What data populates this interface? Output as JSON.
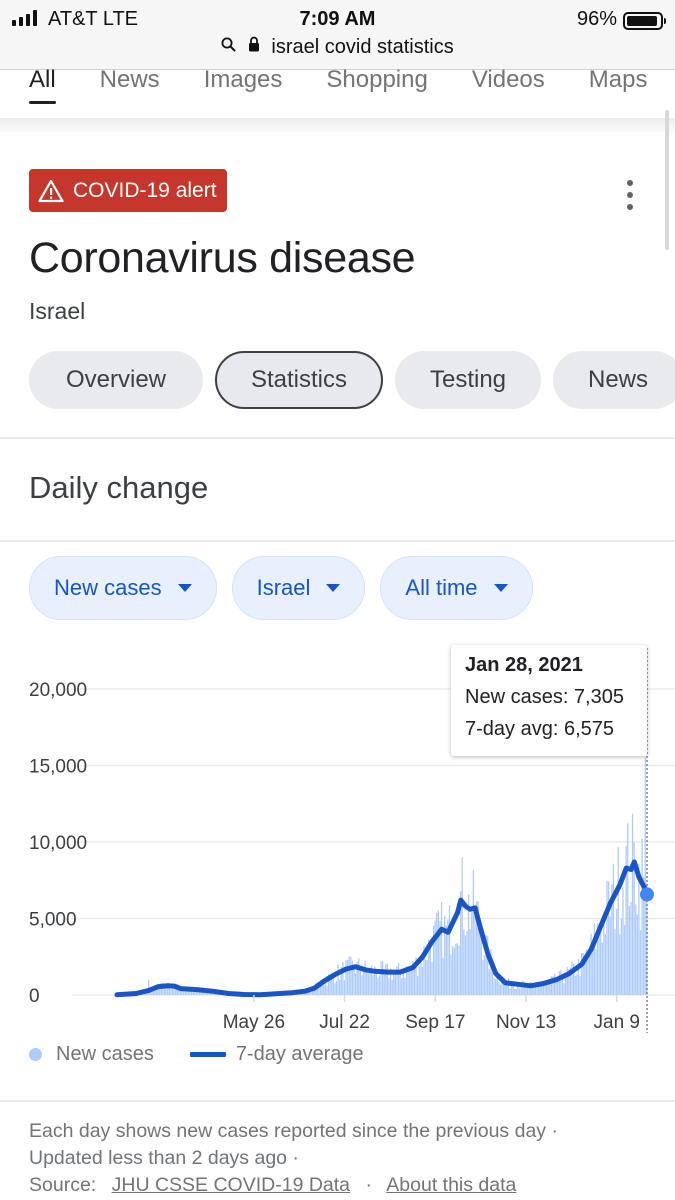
{
  "status_bar": {
    "carrier": "AT&T  LTE",
    "time": "7:09 AM",
    "battery": "96%",
    "battery_level": 0.96
  },
  "address_bar": {
    "search_icon": "search-icon",
    "lock_icon": "lock-icon",
    "query": "israel covid statistics"
  },
  "search_tabs": [
    {
      "label": "All",
      "active": true
    },
    {
      "label": "News",
      "active": false
    },
    {
      "label": "Images",
      "active": false
    },
    {
      "label": "Shopping",
      "active": false
    },
    {
      "label": "Videos",
      "active": false
    },
    {
      "label": "Maps",
      "active": false
    }
  ],
  "card": {
    "alert_icon": "warning-icon",
    "alert_label": "COVID-19 alert",
    "alert_color": "#c5362d",
    "more_icon": "more-vert-icon",
    "title": "Coronavirus disease",
    "subtitle": "Israel",
    "chips": [
      {
        "label": "Overview",
        "selected": false
      },
      {
        "label": "Statistics",
        "selected": true
      },
      {
        "label": "Testing",
        "selected": false
      },
      {
        "label": "News",
        "selected": false
      }
    ]
  },
  "section": {
    "title": "Daily change",
    "filters": [
      {
        "label": "New cases"
      },
      {
        "label": "Israel"
      },
      {
        "label": "All time"
      }
    ]
  },
  "tooltip": {
    "date": "Jan 28, 2021",
    "new_cases": "New cases: 7,305",
    "avg": "7-day avg: 6,575"
  },
  "legend": {
    "new_cases": "New cases",
    "avg": "7-day average"
  },
  "footer": {
    "line1": "Each day shows new cases reported since the previous day ·",
    "line2": "Updated less than 2 days ago  ·",
    "source_label": "Source:",
    "source_link": "JHU CSSE COVID-19 Data",
    "about_link": "About this data"
  },
  "chart_data": {
    "type": "bar",
    "title": "Daily change",
    "xlabel": "",
    "ylabel": "",
    "ylim": [
      0,
      20000
    ],
    "yticks": [
      0,
      5000,
      10000,
      15000,
      20000
    ],
    "ytick_labels": [
      "0",
      "5,000",
      "10,000",
      "15,000",
      "20,000"
    ],
    "x_start": "2020-03-01",
    "x_end": "2021-01-28",
    "x_range_days": [
      0,
      333
    ],
    "xticks_day": [
      86,
      143,
      200,
      257,
      314
    ],
    "xtick_labels": [
      "May 26",
      "Jul 22",
      "Sep 17",
      "Nov 13",
      "Jan 9"
    ],
    "grid": true,
    "legend_position": "bottom-left",
    "colors": {
      "bars": "#aecbfa",
      "avg_line": "#1a55c7",
      "highlight_dot": "#4285f4"
    },
    "series": [
      {
        "name": "7-day average",
        "type": "line",
        "points_day_value": [
          [
            0,
            10
          ],
          [
            12,
            100
          ],
          [
            20,
            300
          ],
          [
            26,
            550
          ],
          [
            32,
            600
          ],
          [
            36,
            580
          ],
          [
            40,
            420
          ],
          [
            50,
            350
          ],
          [
            60,
            250
          ],
          [
            70,
            100
          ],
          [
            80,
            30
          ],
          [
            90,
            20
          ],
          [
            100,
            80
          ],
          [
            110,
            150
          ],
          [
            118,
            250
          ],
          [
            124,
            450
          ],
          [
            130,
            900
          ],
          [
            138,
            1400
          ],
          [
            144,
            1700
          ],
          [
            150,
            1850
          ],
          [
            156,
            1650
          ],
          [
            162,
            1550
          ],
          [
            170,
            1500
          ],
          [
            178,
            1500
          ],
          [
            186,
            1800
          ],
          [
            192,
            2500
          ],
          [
            198,
            3500
          ],
          [
            204,
            4300
          ],
          [
            208,
            4100
          ],
          [
            214,
            5400
          ],
          [
            216,
            6200
          ],
          [
            219,
            5800
          ],
          [
            222,
            5600
          ],
          [
            225,
            5700
          ],
          [
            228,
            4500
          ],
          [
            233,
            2700
          ],
          [
            238,
            1400
          ],
          [
            244,
            800
          ],
          [
            252,
            700
          ],
          [
            260,
            600
          ],
          [
            268,
            750
          ],
          [
            276,
            1000
          ],
          [
            284,
            1400
          ],
          [
            292,
            2000
          ],
          [
            298,
            3000
          ],
          [
            304,
            4500
          ],
          [
            310,
            6000
          ],
          [
            316,
            7200
          ],
          [
            320,
            8300
          ],
          [
            323,
            8200
          ],
          [
            325,
            8700
          ],
          [
            328,
            7700
          ],
          [
            330,
            7300
          ],
          [
            332,
            6900
          ],
          [
            333,
            6575
          ]
        ]
      },
      {
        "name": "New cases",
        "type": "bar",
        "highlight": {
          "day": 333,
          "value": 7305,
          "avg": 6575
        }
      }
    ]
  }
}
